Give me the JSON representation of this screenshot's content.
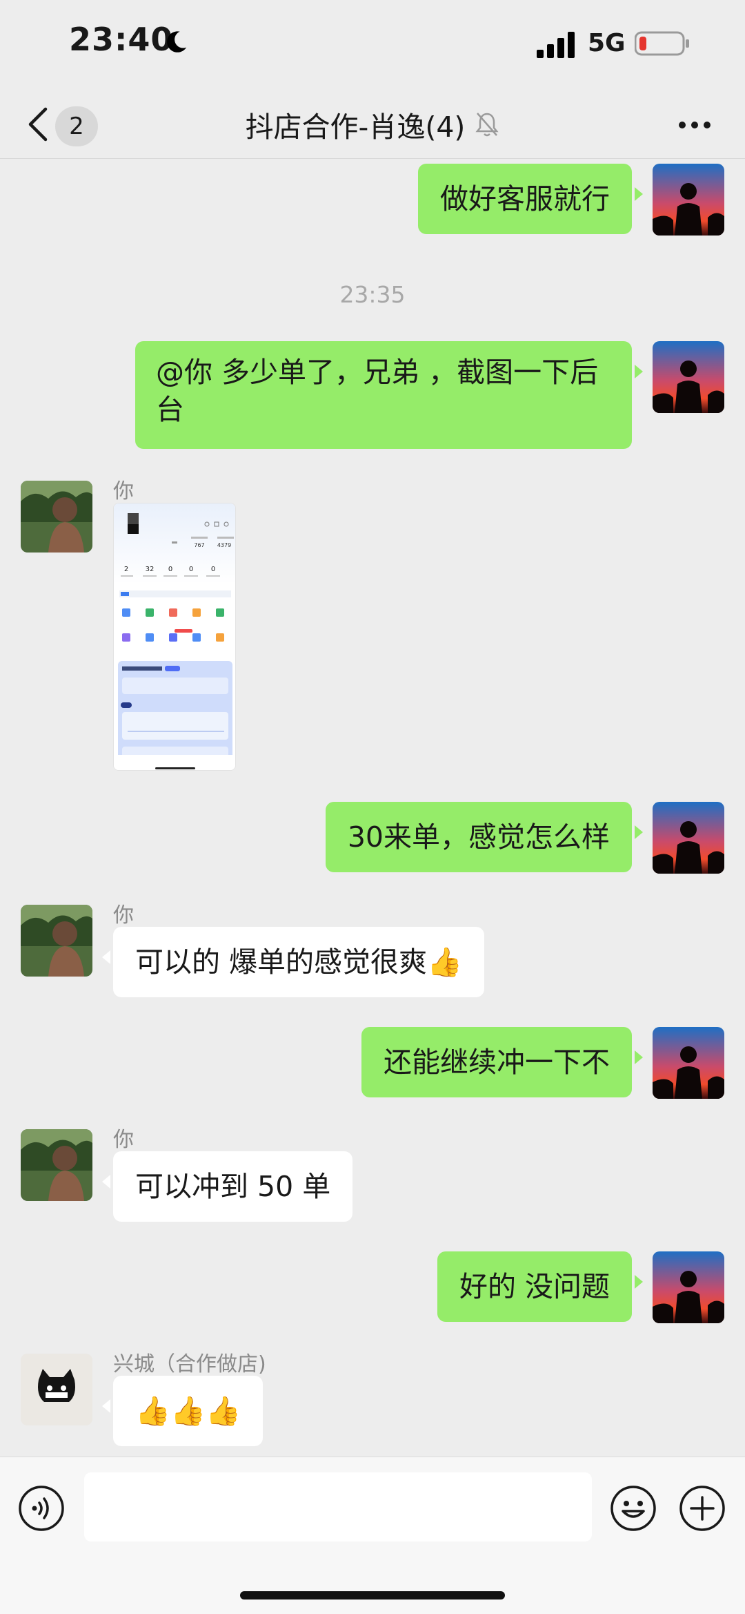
{
  "status_bar": {
    "time": "23:40",
    "network": "5G",
    "battery_color": "#e5362f"
  },
  "nav": {
    "unread_count": "2",
    "title": "抖店合作-肖逸(4)"
  },
  "colors": {
    "my_bubble": "#95ec69",
    "other_bubble": "#ffffff",
    "background": "#ededed"
  },
  "messages": {
    "m1": {
      "text": "做好客服就行"
    },
    "timestamp": "23:35",
    "m2": {
      "text": "@你 多少单了，兄弟 ，截图一下后台"
    },
    "m3": {
      "sender": "你",
      "content": "image"
    },
    "m4": {
      "text": "30来单，感觉怎么样"
    },
    "m5": {
      "sender": "你",
      "text": "可以的 爆单的感觉很爽👍"
    },
    "m6": {
      "text": "还能继续冲一下不"
    },
    "m7": {
      "sender": "你",
      "text": "可以冲到 50 单"
    },
    "m8": {
      "text": "好的 没问题"
    },
    "m9": {
      "sender": "兴城（合作做店)",
      "text": "👍👍👍"
    }
  },
  "screenshot_thumb": {
    "stats": [
      "2",
      "32",
      "0",
      "0",
      "0"
    ],
    "top_numbers": [
      "767",
      "4379"
    ]
  },
  "input": {
    "placeholder": ""
  }
}
